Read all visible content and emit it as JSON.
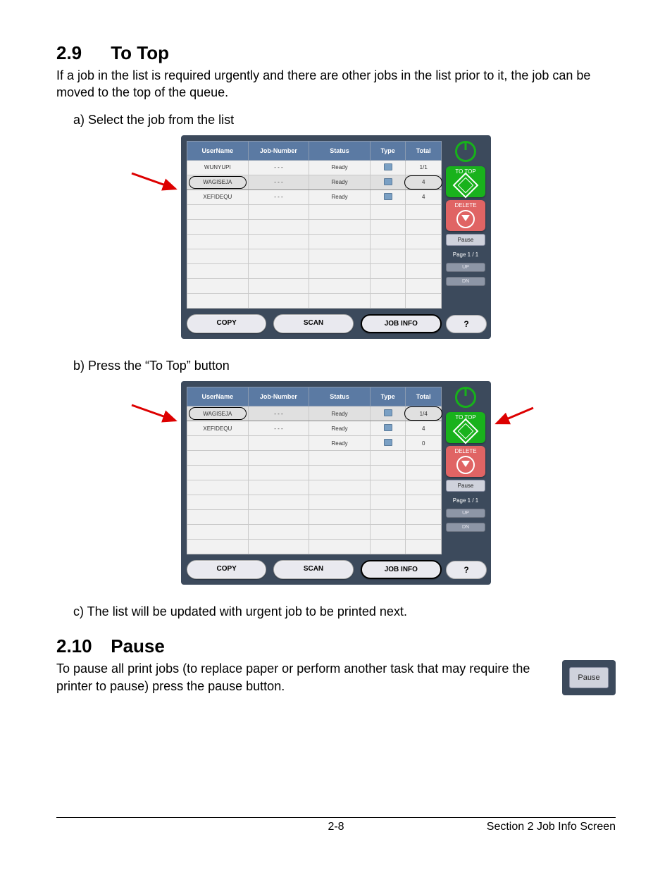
{
  "section29": {
    "heading_num": "2.9",
    "heading_title": "To Top",
    "intro": "If a job in the list is required urgently and there are other jobs in the list prior to it, the job can be moved to the top of the queue.",
    "step_a": "a)  Select the job from the list",
    "step_b": "b)  Press the “To Top” button",
    "step_c": "c)  The list will be updated with urgent job to be printed next."
  },
  "section210": {
    "heading_num": "2.10",
    "heading_title": "Pause",
    "body": "To pause all print jobs (to replace paper or perform another task that may require the printer to pause) press the pause button."
  },
  "ui_common": {
    "headers": {
      "user": "UserName",
      "job": "Job-Number",
      "status": "Status",
      "type": "Type",
      "total": "Total"
    },
    "buttons": {
      "copy": "COPY",
      "scan": "SCAN",
      "jobinfo": "JOB INFO",
      "help": "?"
    },
    "side": {
      "totop": "TO TOP",
      "delete": "DELETE",
      "pause": "Pause",
      "page": "Page  1 / 1",
      "up": "UP",
      "dn": "DN"
    }
  },
  "shot1_rows": [
    {
      "user": "WUNYUPI",
      "job": "- - -",
      "status": "Ready",
      "type": "printer",
      "total": "1/1"
    },
    {
      "user": "WAGISEJA",
      "job": "- - -",
      "status": "Ready",
      "type": "printer",
      "total": "4",
      "selected": true
    },
    {
      "user": "XEFIDEQU",
      "job": "- - -",
      "status": "Ready",
      "type": "printer",
      "total": "4"
    }
  ],
  "shot2_rows": [
    {
      "user": "WAGISEJA",
      "job": "- - -",
      "status": "Ready",
      "type": "printer",
      "total": "1/4",
      "selected": true
    },
    {
      "user": "XEFIDEQU",
      "job": "- - -",
      "status": "Ready",
      "type": "printer",
      "total": "4"
    },
    {
      "user": "",
      "job": "",
      "status": "Ready",
      "type": "printer",
      "total": "0"
    }
  ],
  "footer": {
    "page": "2-8",
    "section": "Section 2    Job Info Screen"
  }
}
